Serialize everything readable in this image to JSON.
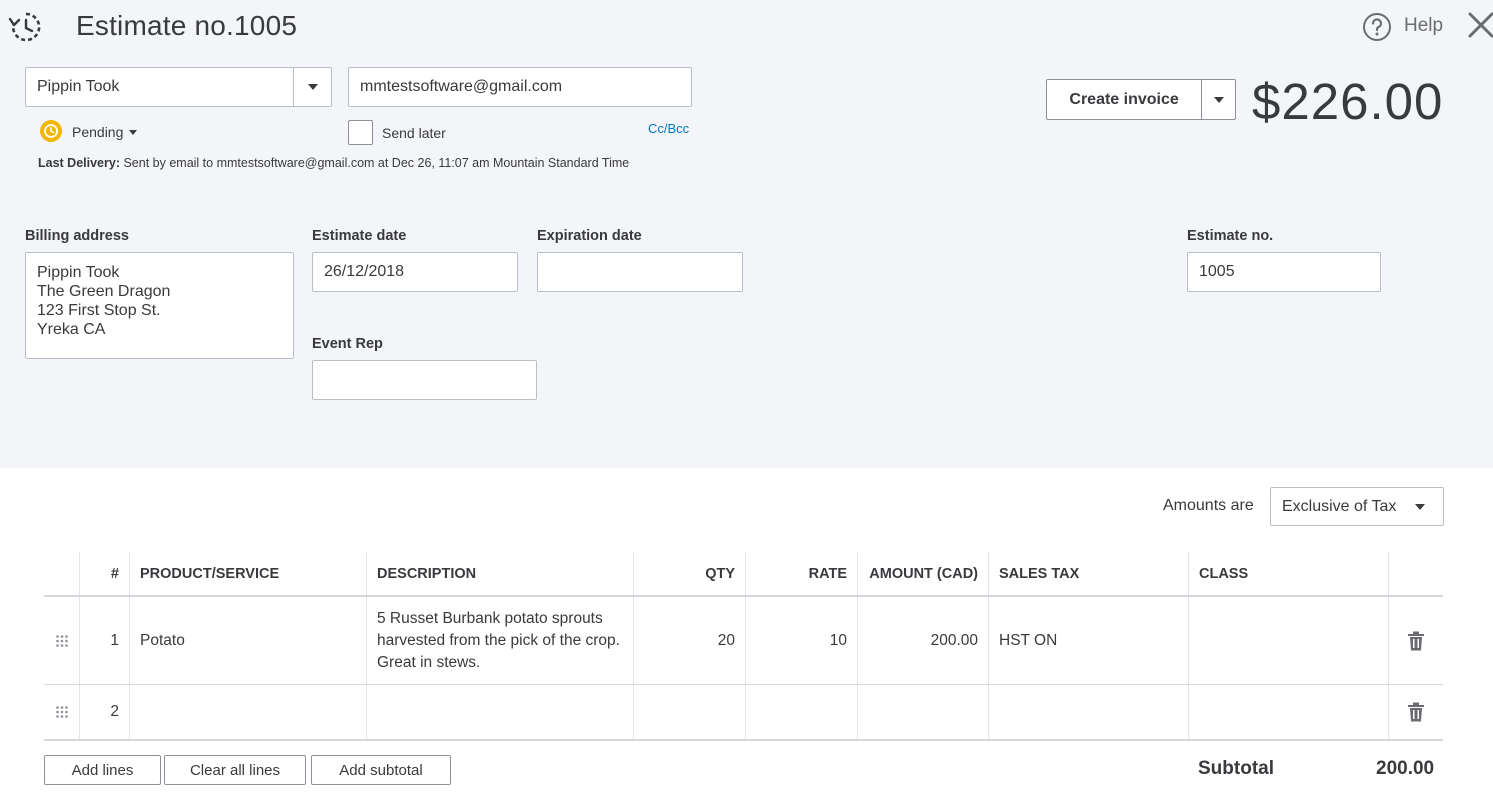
{
  "header": {
    "title": "Estimate no.1005",
    "help_label": "Help"
  },
  "customer": {
    "name": "Pippin Took",
    "email": "mmtestsoftware@gmail.com"
  },
  "status": {
    "label": "Pending",
    "send_later_label": "Send later",
    "send_later_checked": false,
    "cc_bcc_label": "Cc/Bcc",
    "last_delivery_label": "Last Delivery:",
    "last_delivery_text": "Sent by email to mmtestsoftware@gmail.com at Dec 26, 11:07 am Mountain Standard Time"
  },
  "actions": {
    "create_invoice_label": "Create invoice"
  },
  "total_amount": "$226.00",
  "form": {
    "billing_address_label": "Billing address",
    "billing_address_lines": [
      "Pippin Took",
      "The Green Dragon",
      "123 First Stop St.",
      "Yreka CA"
    ],
    "estimate_date_label": "Estimate date",
    "estimate_date_value": "26/12/2018",
    "expiration_date_label": "Expiration date",
    "expiration_date_value": "",
    "estimate_no_label": "Estimate no.",
    "estimate_no_value": "1005",
    "event_rep_label": "Event Rep",
    "event_rep_value": ""
  },
  "amounts": {
    "label": "Amounts are",
    "selected": "Exclusive of Tax"
  },
  "table": {
    "columns": [
      "#",
      "PRODUCT/SERVICE",
      "DESCRIPTION",
      "QTY",
      "RATE",
      "AMOUNT (CAD)",
      "SALES TAX",
      "CLASS"
    ],
    "rows": [
      {
        "num": "1",
        "product": "Potato",
        "description": "5 Russet Burbank potato sprouts harvested from the pick of the crop. Great in stews.",
        "qty": "20",
        "rate": "10",
        "amount": "200.00",
        "tax": "HST ON",
        "class": ""
      },
      {
        "num": "2",
        "product": "",
        "description": "",
        "qty": "",
        "rate": "",
        "amount": "",
        "tax": "",
        "class": ""
      }
    ]
  },
  "buttons": {
    "add_lines": "Add lines",
    "clear_all_lines": "Clear all lines",
    "add_subtotal": "Add subtotal"
  },
  "summary": {
    "subtotal_label": "Subtotal",
    "subtotal_value": "200.00"
  },
  "colors": {
    "accent_link": "#0077c5",
    "pending": "#f2b705",
    "top_bg": "#f4f5f8"
  },
  "icons": {
    "history": "history-icon",
    "help": "help-icon",
    "close": "close-icon",
    "pending": "pending-clock-icon",
    "drag": "drag-handle-icon",
    "delete": "trash-icon"
  }
}
